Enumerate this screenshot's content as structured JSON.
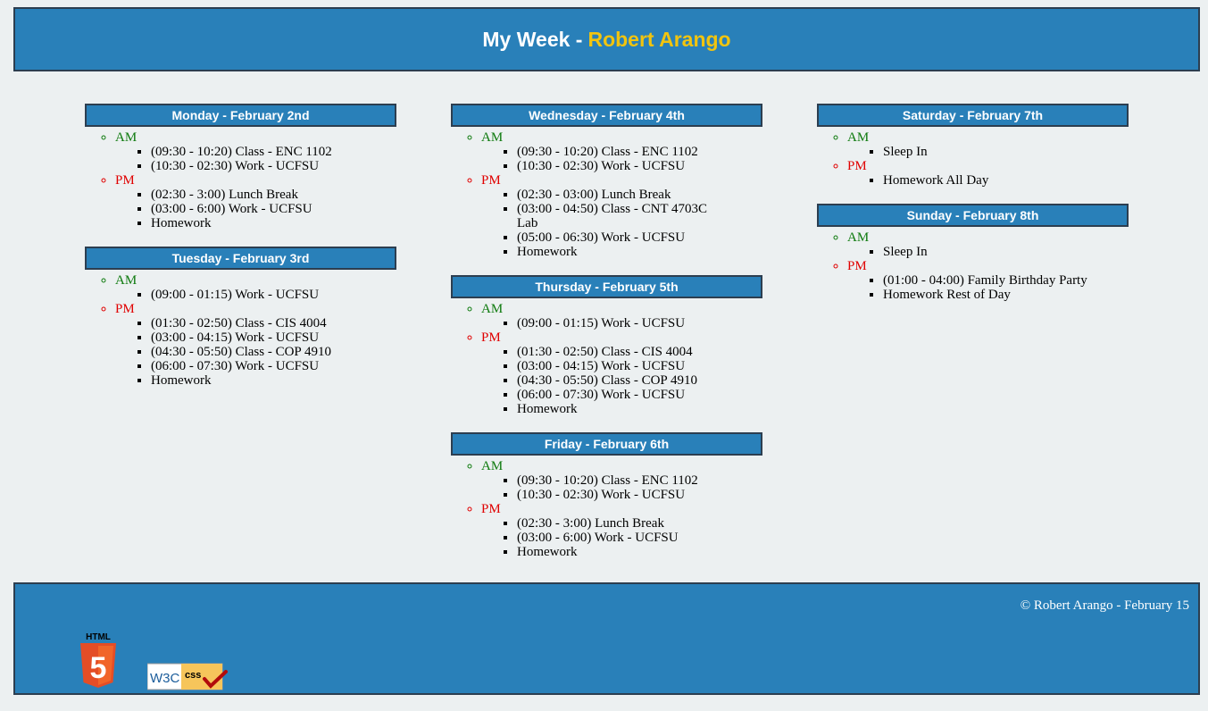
{
  "header": {
    "title_prefix": "My Week -",
    "name": "Robert Arango"
  },
  "labels": {
    "am": "AM",
    "pm": "PM"
  },
  "days": [
    {
      "title": "Monday - February 2nd",
      "am": [
        "(09:30 - 10:20) Class - ENC 1102",
        "(10:30 - 02:30) Work - UCFSU"
      ],
      "pm": [
        "(02:30 - 3:00) Lunch Break",
        "(03:00 - 6:00) Work - UCFSU",
        "Homework"
      ]
    },
    {
      "title": "Tuesday - February 3rd",
      "am": [
        "(09:00 - 01:15) Work - UCFSU"
      ],
      "pm": [
        "(01:30 - 02:50) Class - CIS 4004",
        "(03:00 - 04:15) Work - UCFSU",
        "(04:30 - 05:50) Class - COP 4910",
        "(06:00 - 07:30) Work - UCFSU",
        "Homework"
      ]
    },
    {
      "title": "Wednesday - February 4th",
      "am": [
        "(09:30 - 10:20) Class - ENC 1102",
        "(10:30 - 02:30) Work - UCFSU"
      ],
      "pm": [
        "(02:30 - 03:00) Lunch Break",
        "(03:00 - 04:50) Class - CNT 4703C Lab",
        "(05:00 - 06:30) Work - UCFSU",
        "Homework"
      ]
    },
    {
      "title": "Thursday - February 5th",
      "am": [
        "(09:00 - 01:15) Work - UCFSU"
      ],
      "pm": [
        "(01:30 - 02:50) Class - CIS 4004",
        "(03:00 - 04:15) Work - UCFSU",
        "(04:30 - 05:50) Class - COP 4910",
        "(06:00 - 07:30) Work - UCFSU",
        "Homework"
      ]
    },
    {
      "title": "Friday - February 6th",
      "am": [
        "(09:30 - 10:20) Class - ENC 1102",
        "(10:30 - 02:30) Work - UCFSU"
      ],
      "pm": [
        "(02:30 - 3:00) Lunch Break",
        "(03:00 - 6:00) Work - UCFSU",
        "Homework"
      ]
    },
    {
      "title": "Saturday - February 7th",
      "am": [
        "Sleep In"
      ],
      "pm": [
        "Homework All Day"
      ]
    },
    {
      "title": "Sunday - February 8th",
      "am": [
        "Sleep In"
      ],
      "pm": [
        "(01:00 - 04:00) Family Birthday Party",
        "Homework Rest of Day"
      ]
    }
  ],
  "footer": {
    "copyright": "© Robert Arango - February 15",
    "html5_badge": {
      "icon": "html5-logo-icon",
      "text": "HTML",
      "digit": "5",
      "color": "#e44d26"
    },
    "css_badge": {
      "icon": "w3c-css-valid-icon",
      "w3c_text": "W3C",
      "css_text": "css"
    }
  }
}
